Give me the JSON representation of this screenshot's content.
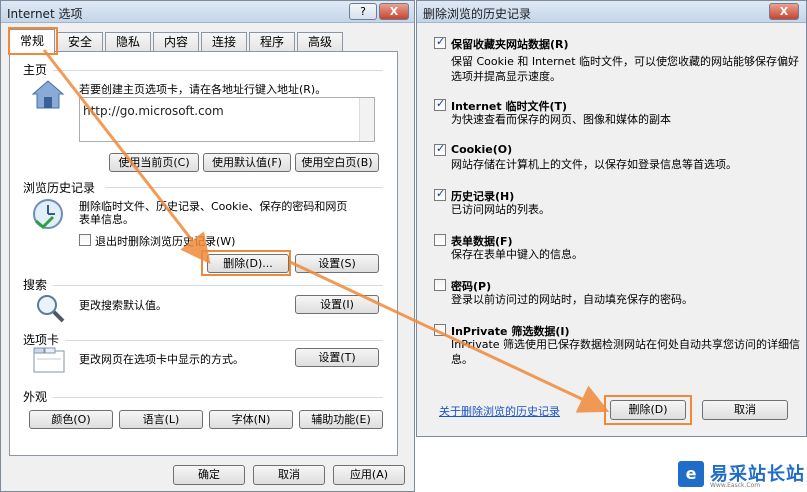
{
  "left_dialog": {
    "title": "Internet 选项",
    "title_buttons": {
      "help": "?",
      "close": "X"
    },
    "tabs": [
      {
        "label": "常规",
        "active": true
      },
      {
        "label": "安全"
      },
      {
        "label": "隐私"
      },
      {
        "label": "内容"
      },
      {
        "label": "连接"
      },
      {
        "label": "程序"
      },
      {
        "label": "高级"
      }
    ],
    "home": {
      "group": "主页",
      "desc": "若要创建主页选项卡，请在各地址行键入地址(R)。",
      "url": "http://go.microsoft.com",
      "buttons": {
        "current": "使用当前页(C)",
        "default": "使用默认值(F)",
        "blank": "使用空白页(B)"
      }
    },
    "history": {
      "group": "浏览历史记录",
      "desc_line1": "删除临时文件、历史记录、Cookie、保存的密码和网页",
      "desc_line2": "表单信息。",
      "checkbox_label": "退出时删除浏览历史记录(W)",
      "delete_button": "删除(D)...",
      "settings_button": "设置(S)"
    },
    "search": {
      "group": "搜索",
      "desc": "更改搜索默认值。",
      "settings_button": "设置(I)"
    },
    "tabs_section": {
      "group": "选项卡",
      "desc": "更改网页在选项卡中显示的方式。",
      "settings_button": "设置(T)"
    },
    "appearance": {
      "group": "外观",
      "buttons": {
        "colors": "颜色(O)",
        "languages": "语言(L)",
        "fonts": "字体(N)",
        "accessibility": "辅助功能(E)"
      }
    },
    "footer": {
      "ok": "确定",
      "cancel": "取消",
      "apply": "应用(A)"
    }
  },
  "right_dialog": {
    "title": "删除浏览的历史记录",
    "close": "X",
    "options": [
      {
        "title": "保留收藏夹网站数据(R)",
        "checked": true,
        "desc": "保留 Cookie 和 Internet 临时文件，可以使您收藏的网站能够保存偏好选项并提高显示速度。"
      },
      {
        "title": "Internet 临时文件(T)",
        "checked": true,
        "desc": "为快速查看而保存的网页、图像和媒体的副本"
      },
      {
        "title": "Cookie(O)",
        "checked": true,
        "desc": "网站存储在计算机上的文件，以保存如登录信息等首选项。"
      },
      {
        "title": "历史记录(H)",
        "checked": true,
        "desc": "已访问网站的列表。"
      },
      {
        "title": "表单数据(F)",
        "checked": false,
        "desc": "保存在表单中键入的信息。"
      },
      {
        "title": "密码(P)",
        "checked": false,
        "desc": "登录以前访问过的网站时，自动填充保存的密码。"
      },
      {
        "title": "InPrivate 筛选数据(I)",
        "checked": false,
        "desc": "InPrivate 筛选使用已保存数据检测网站在何处自动共享您访问的详细信息。"
      }
    ],
    "link": "关于删除浏览的历史记录",
    "delete_button": "删除(D)",
    "cancel_button": "取消"
  },
  "watermark": {
    "text": "易采站长站",
    "sub": "Www.Easck.Com"
  },
  "colors": {
    "highlight": "#f08a3a",
    "link": "#1c55c5"
  }
}
